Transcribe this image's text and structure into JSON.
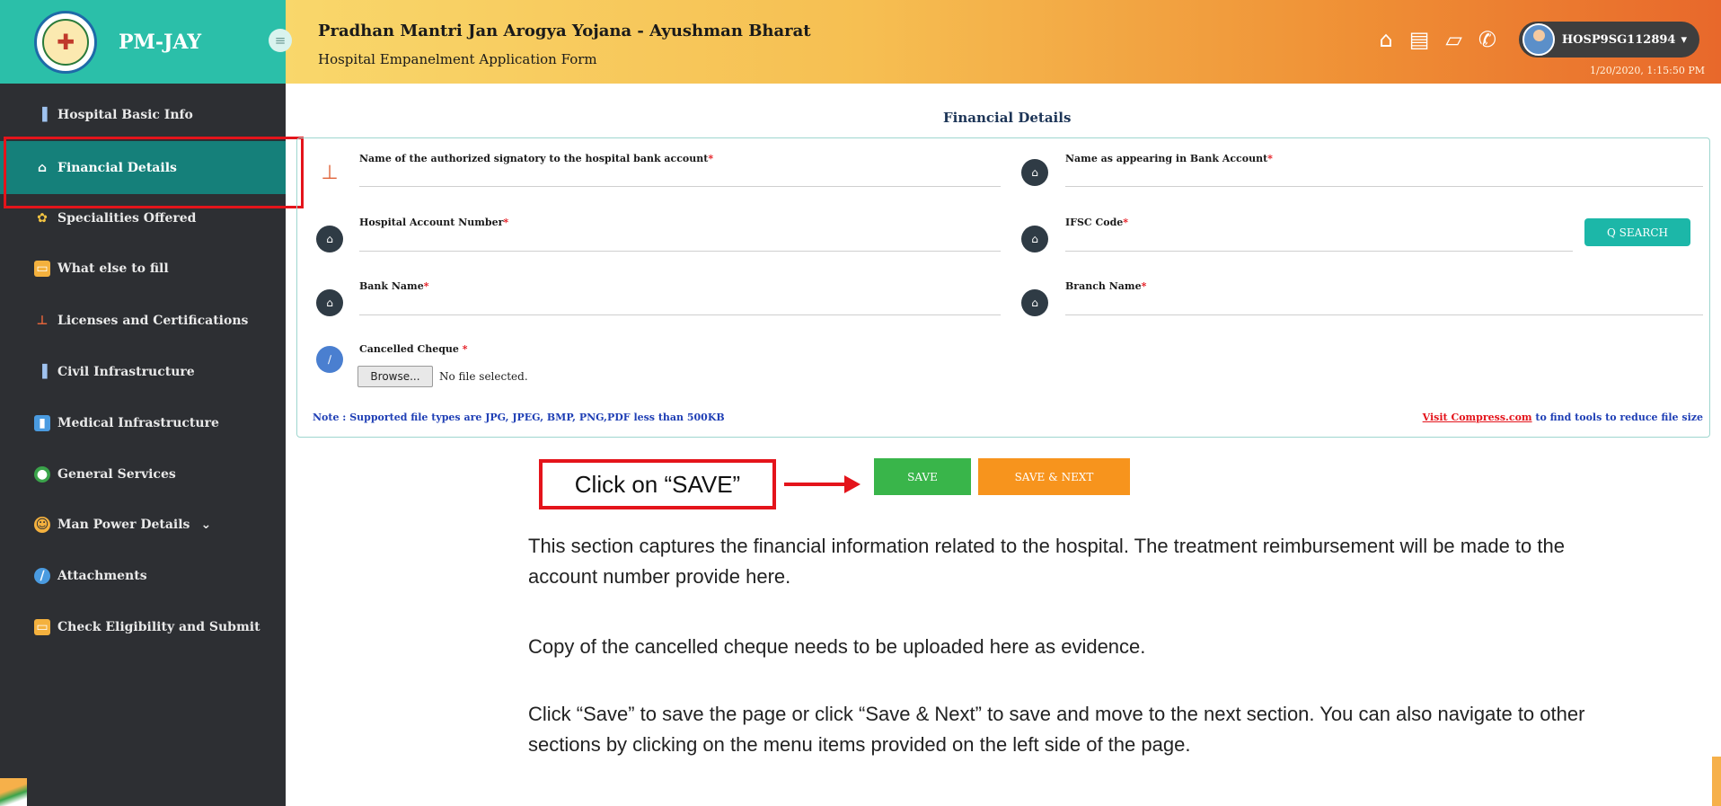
{
  "header": {
    "brand_name": "PM-JAY",
    "title": "Pradhan Mantri Jan Arogya Yojana - Ayushman Bharat",
    "subtitle": "Hospital Empanelment Application Form",
    "username": "HOSP9SG112894",
    "timestamp": "1/20/2020, 1:15:50 PM",
    "icons": [
      "home-icon",
      "document-icon",
      "book-icon",
      "phone-icon"
    ]
  },
  "sidebar": {
    "items": [
      {
        "label": "Hospital Basic Info",
        "icon": "hospital-icon"
      },
      {
        "label": "Financial Details",
        "icon": "bank-icon",
        "active": true
      },
      {
        "label": "Specialities Offered",
        "icon": "specialities-icon"
      },
      {
        "label": "What else to fill",
        "icon": "form-icon"
      },
      {
        "label": "Licenses and Certifications",
        "icon": "stamp-icon"
      },
      {
        "label": "Civil Infrastructure",
        "icon": "building-icon"
      },
      {
        "label": "Medical Infrastructure",
        "icon": "medical-icon"
      },
      {
        "label": "General Services",
        "icon": "services-icon"
      },
      {
        "label": "Man Power Details",
        "icon": "people-icon"
      },
      {
        "label": "Attachments",
        "icon": "attachment-icon"
      },
      {
        "label": "Check Eligibility and Submit",
        "icon": "checklist-icon"
      }
    ]
  },
  "form": {
    "section_title": "Financial Details",
    "fields": {
      "signatory": "Name of the authorized signatory to the hospital bank account",
      "name_in_bank": "Name as appearing in Bank Account",
      "account_number": "Hospital Account Number",
      "ifsc": "IFSC Code",
      "bank_name": "Bank Name",
      "branch_name": "Branch Name",
      "cheque": "Cancelled Cheque "
    },
    "required_mark": "*",
    "search_label": "Q SEARCH",
    "browse_label": "Browse...",
    "no_file": "No file selected.",
    "note": "Note : Supported file types are JPG, JPEG, BMP, PNG,PDF less than 500KB",
    "compress_link": "Visit Compress.com",
    "compress_text": " to find tools to reduce file size",
    "save_label": "SAVE",
    "save_next_label": "SAVE & NEXT"
  },
  "annotation": {
    "callout": "Click on “SAVE”",
    "paragraphs": [
      "This section captures the financial information related to the hospital. The treatment reimbursement will be made to the account number provide here.",
      "Copy of the cancelled cheque needs to be uploaded here as evidence.",
      "Click “Save” to save the page or click “Save & Next” to save and move to the next section. You can also navigate to other sections by clicking on the menu items provided on the left side of the page."
    ]
  },
  "colors": {
    "sidebar_bg": "#2d2f33",
    "active_item": "#15807a",
    "brand_bg": "#2bbfa9",
    "save_green": "#39b54a",
    "save_next_orange": "#f7941d",
    "highlight_red": "#e4141b"
  }
}
